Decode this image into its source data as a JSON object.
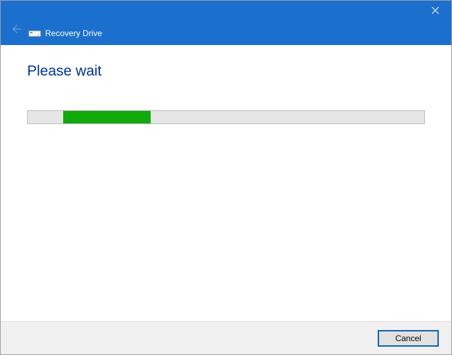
{
  "window": {
    "title": "Recovery Drive"
  },
  "content": {
    "heading": "Please wait"
  },
  "progress": {
    "left_percent": 9,
    "width_percent": 22
  },
  "buttons": {
    "cancel": "Cancel"
  }
}
